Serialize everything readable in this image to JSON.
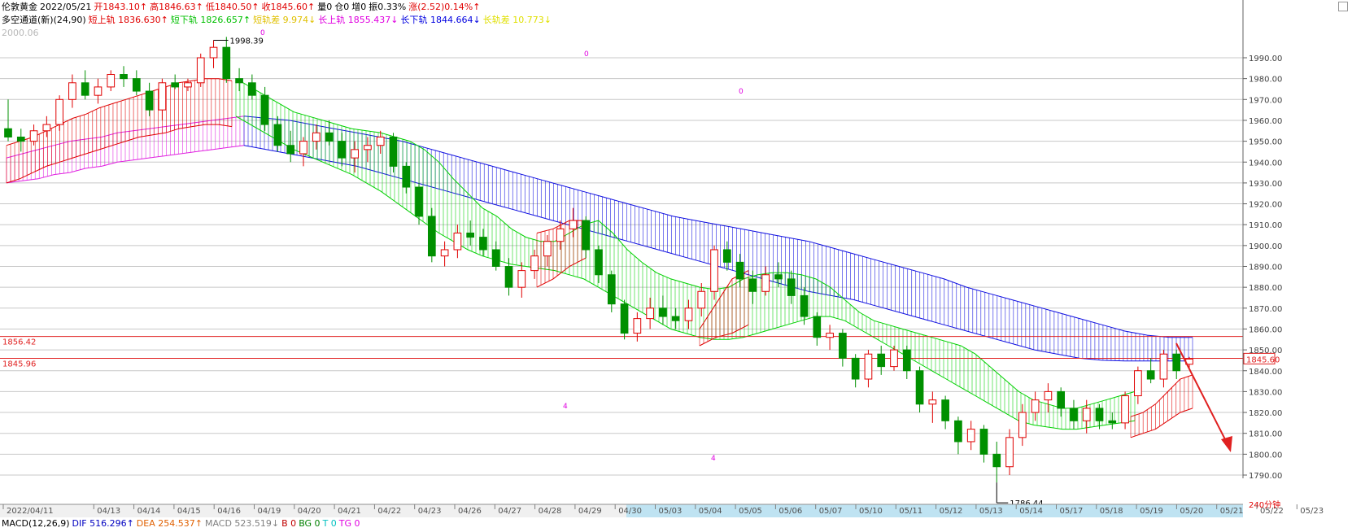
{
  "header": {
    "line1": [
      {
        "text": "伦敦黄金",
        "color": "#000000"
      },
      {
        "text": "2022/05/21",
        "color": "#000000"
      },
      {
        "text": "开1843.10↑",
        "color": "#e00000"
      },
      {
        "text": "高1846.63↑",
        "color": "#e00000"
      },
      {
        "text": "低1840.50↑",
        "color": "#e00000"
      },
      {
        "text": "收1845.60↑",
        "color": "#e00000"
      },
      {
        "text": "量0",
        "color": "#000000"
      },
      {
        "text": "仓0",
        "color": "#000000"
      },
      {
        "text": "增0",
        "color": "#000000"
      },
      {
        "text": "振0.33%",
        "color": "#000000"
      },
      {
        "text": "涨(2.52)0.14%↑",
        "color": "#e00000"
      }
    ],
    "line2": [
      {
        "text": "多空通道(新)(24,90)",
        "color": "#000000"
      },
      {
        "text": "短上轨 1836.630↑",
        "color": "#e00000"
      },
      {
        "text": "短下轨 1826.657↑",
        "color": "#00c000"
      },
      {
        "text": "短轨差 9.974↓",
        "color": "#e0c000"
      },
      {
        "text": "长上轨 1855.437↓",
        "color": "#e000e0"
      },
      {
        "text": "长下轨 1844.664↓",
        "color": "#0000e0"
      },
      {
        "text": "长轨差 10.773↓",
        "color": "#e0e000"
      }
    ],
    "top_value": "2000.06"
  },
  "footer": [
    {
      "text": "MACD(12,26,9)",
      "color": "#000000"
    },
    {
      "text": "DIF 516.296↑",
      "color": "#0000c0"
    },
    {
      "text": "DEA 254.537↑",
      "color": "#e06000"
    },
    {
      "text": "MACD 523.519↓",
      "color": "#808080"
    },
    {
      "text": "B 0",
      "color": "#c00000"
    },
    {
      "text": "BG 0",
      "color": "#008000"
    },
    {
      "text": "T 0",
      "color": "#00c0c0"
    },
    {
      "text": "TG 0",
      "color": "#e000e0"
    }
  ],
  "timeframe": "240分钟",
  "marks": {
    "high_label": "1998.39",
    "low_label": "1786.44",
    "hline1_label": "1856.42",
    "hline2_label": "1845.96",
    "last_price_label": "1845.60",
    "zeros": [
      "0",
      "0",
      "0"
    ],
    "fours": [
      "4",
      "4"
    ]
  },
  "colors": {
    "up": "#e00000",
    "down": "#009000",
    "green_band": "#00d000",
    "red_band": "#e00000",
    "blue_band": "#1010e0",
    "magenta_band": "#e020e0",
    "hline": "#e02020",
    "grid": "#c8c8c8",
    "arrow": "#e02020"
  },
  "chart_data": {
    "type": "candlestick",
    "ylim": [
      1785,
      2000
    ],
    "yticks": [
      1790,
      1800,
      1810,
      1820,
      1830,
      1840,
      1850,
      1860,
      1870,
      1880,
      1890,
      1900,
      1910,
      1920,
      1930,
      1940,
      1950,
      1960,
      1970,
      1980,
      1990
    ],
    "date_labels": [
      "2022/04/11",
      "04/13",
      "04/14",
      "04/15",
      "04/16",
      "04/19",
      "04/20",
      "04/21",
      "04/22",
      "04/23",
      "04/26",
      "04/27",
      "04/28",
      "04/29",
      "04/30",
      "05/03",
      "05/04",
      "05/05",
      "05/06",
      "05/07",
      "05/10",
      "05/11",
      "05/12",
      "05/13",
      "05/14",
      "05/17",
      "05/18",
      "05/19",
      "05/20",
      "05/21",
      "05/22",
      "05/23"
    ],
    "horizontal_lines": [
      1856.42,
      1845.96
    ],
    "high": 1998.39,
    "low": 1786.44,
    "last_price": 1845.6,
    "ohlc": [
      [
        1956,
        1970,
        1950,
        1952
      ],
      [
        1952,
        1956,
        1945,
        1950
      ],
      [
        1950,
        1958,
        1948,
        1955
      ],
      [
        1955,
        1962,
        1952,
        1958
      ],
      [
        1958,
        1972,
        1955,
        1970
      ],
      [
        1970,
        1982,
        1966,
        1978
      ],
      [
        1978,
        1984,
        1970,
        1972
      ],
      [
        1972,
        1980,
        1968,
        1976
      ],
      [
        1976,
        1984,
        1974,
        1982
      ],
      [
        1982,
        1986,
        1976,
        1980
      ],
      [
        1980,
        1984,
        1972,
        1974
      ],
      [
        1974,
        1978,
        1962,
        1965
      ],
      [
        1965,
        1980,
        1960,
        1978
      ],
      [
        1978,
        1982,
        1975,
        1976
      ],
      [
        1976,
        1980,
        1974,
        1978
      ],
      [
        1978,
        1992,
        1976,
        1990
      ],
      [
        1990,
        1998.39,
        1985,
        1995
      ],
      [
        1995,
        2000,
        1978,
        1980
      ],
      [
        1980,
        1985,
        1974,
        1978
      ],
      [
        1978,
        1982,
        1970,
        1972
      ],
      [
        1972,
        1976,
        1955,
        1958
      ],
      [
        1958,
        1962,
        1945,
        1948
      ],
      [
        1948,
        1955,
        1940,
        1944
      ],
      [
        1944,
        1952,
        1938,
        1950
      ],
      [
        1950,
        1958,
        1946,
        1954
      ],
      [
        1954,
        1960,
        1948,
        1950
      ],
      [
        1950,
        1954,
        1938,
        1942
      ],
      [
        1942,
        1950,
        1935,
        1946
      ],
      [
        1946,
        1952,
        1940,
        1948
      ],
      [
        1948,
        1955,
        1944,
        1952
      ],
      [
        1952,
        1954,
        1935,
        1938
      ],
      [
        1938,
        1940,
        1925,
        1928
      ],
      [
        1928,
        1930,
        1910,
        1914
      ],
      [
        1914,
        1918,
        1892,
        1895
      ],
      [
        1895,
        1902,
        1890,
        1898
      ],
      [
        1898,
        1910,
        1894,
        1906
      ],
      [
        1906,
        1912,
        1900,
        1904
      ],
      [
        1904,
        1908,
        1895,
        1898
      ],
      [
        1898,
        1902,
        1888,
        1890
      ],
      [
        1890,
        1894,
        1876,
        1880
      ],
      [
        1880,
        1892,
        1875,
        1888
      ],
      [
        1888,
        1898,
        1884,
        1895
      ],
      [
        1895,
        1905,
        1890,
        1902
      ],
      [
        1902,
        1912,
        1898,
        1908
      ],
      [
        1908,
        1918,
        1904,
        1912
      ],
      [
        1912,
        1914,
        1894,
        1898
      ],
      [
        1898,
        1900,
        1882,
        1886
      ],
      [
        1886,
        1888,
        1868,
        1872
      ],
      [
        1872,
        1874,
        1855,
        1858
      ],
      [
        1858,
        1868,
        1854,
        1865
      ],
      [
        1865,
        1875,
        1860,
        1870
      ],
      [
        1870,
        1876,
        1862,
        1866
      ],
      [
        1866,
        1870,
        1860,
        1864
      ],
      [
        1864,
        1874,
        1860,
        1870
      ],
      [
        1870,
        1882,
        1866,
        1878
      ],
      [
        1878,
        1900,
        1874,
        1898
      ],
      [
        1898,
        1902,
        1888,
        1892
      ],
      [
        1892,
        1896,
        1880,
        1884
      ],
      [
        1884,
        1888,
        1872,
        1878
      ],
      [
        1878,
        1890,
        1876,
        1886
      ],
      [
        1886,
        1892,
        1880,
        1884
      ],
      [
        1884,
        1888,
        1872,
        1876
      ],
      [
        1876,
        1880,
        1862,
        1866
      ],
      [
        1866,
        1868,
        1852,
        1856
      ],
      [
        1856,
        1862,
        1850,
        1858
      ],
      [
        1858,
        1860,
        1842,
        1846
      ],
      [
        1846,
        1848,
        1832,
        1836
      ],
      [
        1836,
        1850,
        1832,
        1848
      ],
      [
        1848,
        1852,
        1838,
        1842
      ],
      [
        1842,
        1852,
        1840,
        1850
      ],
      [
        1850,
        1852,
        1836,
        1840
      ],
      [
        1840,
        1842,
        1820,
        1824
      ],
      [
        1824,
        1830,
        1815,
        1826
      ],
      [
        1826,
        1828,
        1812,
        1816
      ],
      [
        1816,
        1818,
        1800,
        1806
      ],
      [
        1806,
        1816,
        1802,
        1812
      ],
      [
        1812,
        1814,
        1796,
        1800
      ],
      [
        1800,
        1806,
        1786.44,
        1794
      ],
      [
        1794,
        1812,
        1790,
        1808
      ],
      [
        1808,
        1824,
        1804,
        1820
      ],
      [
        1820,
        1830,
        1816,
        1826
      ],
      [
        1826,
        1834,
        1820,
        1830
      ],
      [
        1830,
        1832,
        1818,
        1822
      ],
      [
        1822,
        1826,
        1812,
        1816
      ],
      [
        1816,
        1826,
        1810,
        1822
      ],
      [
        1822,
        1824,
        1812,
        1816
      ],
      [
        1816,
        1820,
        1812,
        1815
      ],
      [
        1815,
        1830,
        1812,
        1828
      ],
      [
        1828,
        1842,
        1824,
        1840
      ],
      [
        1840,
        1846,
        1834,
        1836
      ],
      [
        1836,
        1850,
        1832,
        1848
      ],
      [
        1848,
        1850,
        1836,
        1840
      ],
      [
        1843.1,
        1846.63,
        1840.5,
        1845.6
      ]
    ],
    "bands": {
      "red_upper": [
        1948,
        1950,
        1952,
        1955,
        1958,
        1961,
        1963,
        1966,
        1968,
        1970,
        1972,
        1974,
        1976,
        1978,
        1979,
        1980,
        1980,
        1979
      ],
      "red_lower": [
        1930,
        1932,
        1935,
        1938,
        1940,
        1942,
        1944,
        1946,
        1948,
        1950,
        1952,
        1953,
        1954,
        1956,
        1957,
        1958,
        1958,
        1957
      ],
      "magenta_upper": [
        1942,
        1944,
        1946,
        1948,
        1950,
        1951,
        1952,
        1954,
        1955,
        1956,
        1957,
        1958,
        1959,
        1960,
        1961,
        1962
      ],
      "magenta_lower": [
        1930,
        1931,
        1932,
        1934,
        1935,
        1937,
        1938,
        1940,
        1941,
        1942,
        1943,
        1944,
        1945,
        1946,
        1947,
        1948
      ],
      "green_upper": [
        1980,
        1976,
        1972,
        1968,
        1964,
        1962,
        1960,
        1958,
        1956,
        1955,
        1954,
        1952,
        1950,
        1946,
        1940,
        1932,
        1925,
        1918,
        1914,
        1908,
        1904,
        1902,
        1902,
        1906,
        1910,
        1912,
        1906,
        1898,
        1892,
        1887,
        1884,
        1882,
        1880,
        1879,
        1880,
        1884,
        1886,
        1887,
        1887,
        1886,
        1884,
        1880,
        1874,
        1868,
        1864,
        1862,
        1860,
        1858,
        1856,
        1854,
        1852,
        1848,
        1842,
        1836,
        1830,
        1826,
        1824,
        1822,
        1822,
        1824,
        1826,
        1828,
        1830
      ],
      "green_lower": [
        1962,
        1958,
        1954,
        1950,
        1946,
        1943,
        1940,
        1937,
        1934,
        1930,
        1926,
        1921,
        1916,
        1911,
        1906,
        1902,
        1898,
        1895,
        1893,
        1891,
        1890,
        1889,
        1888,
        1886,
        1884,
        1880,
        1876,
        1872,
        1868,
        1864,
        1860,
        1858,
        1856,
        1855,
        1855,
        1856,
        1858,
        1860,
        1862,
        1864,
        1866,
        1866,
        1864,
        1860,
        1856,
        1852,
        1848,
        1844,
        1840,
        1836,
        1832,
        1828,
        1824,
        1820,
        1816,
        1814,
        1813,
        1812,
        1812,
        1813,
        1814,
        1815,
        1816
      ],
      "blue_upper": [
        1962,
        1961,
        1960,
        1958,
        1956,
        1954,
        1952,
        1950,
        1947,
        1944,
        1941,
        1938,
        1935,
        1932,
        1929,
        1926,
        1923,
        1920,
        1917,
        1914,
        1912,
        1910,
        1908,
        1906,
        1904,
        1902,
        1899,
        1896,
        1893,
        1890,
        1887,
        1884,
        1880,
        1877,
        1874,
        1871,
        1868,
        1865,
        1862,
        1859,
        1857,
        1856,
        1856
      ],
      "blue_lower": [
        1948,
        1946,
        1944,
        1942,
        1940,
        1938,
        1935,
        1932,
        1929,
        1926,
        1923,
        1920,
        1917,
        1914,
        1911,
        1908,
        1905,
        1902,
        1899,
        1896,
        1893,
        1890,
        1887,
        1884,
        1881,
        1878,
        1876,
        1874,
        1871,
        1868,
        1865,
        1862,
        1859,
        1856,
        1853,
        1850,
        1848,
        1846,
        1845,
        1844.7,
        1844.7,
        1844.7,
        1844.7
      ]
    }
  }
}
